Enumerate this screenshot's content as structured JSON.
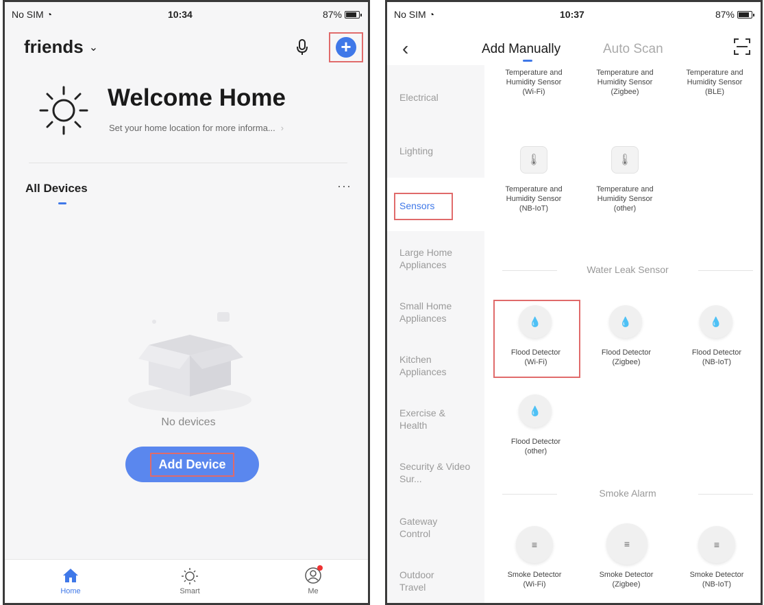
{
  "left": {
    "status": {
      "carrier": "No SIM",
      "time": "10:34",
      "battery": "87%"
    },
    "home_name": "friends",
    "welcome_title": "Welcome Home",
    "welcome_sub": "Set your home location for more informa...",
    "all_devices": "All Devices",
    "more": "···",
    "no_devices": "No devices",
    "add_device": "Add Device",
    "tabs": [
      {
        "label": "Home"
      },
      {
        "label": "Smart"
      },
      {
        "label": "Me"
      }
    ]
  },
  "right": {
    "status": {
      "carrier": "No SIM",
      "time": "10:37",
      "battery": "87%"
    },
    "tab_manual": "Add Manually",
    "tab_scan": "Auto Scan",
    "categories": [
      "Electrical",
      "Lighting",
      "Sensors",
      "Large Home Appliances",
      "Small Home Appliances",
      "Kitchen Appliances",
      "Exercise & Health",
      "Security & Video Sur...",
      "Gateway Control",
      "Outdoor Travel"
    ],
    "th_row1": [
      {
        "name": "Temperature and Humidity Sensor",
        "sub": "(Wi-Fi)"
      },
      {
        "name": "Temperature and Humidity Sensor",
        "sub": "(Zigbee)"
      },
      {
        "name": "Temperature and Humidity Sensor",
        "sub": "(BLE)"
      }
    ],
    "th_row2": [
      {
        "name": "Temperature and Humidity Sensor",
        "sub": "(NB-IoT)"
      },
      {
        "name": "Temperature and Humidity Sensor",
        "sub": "(other)"
      }
    ],
    "water_section": "Water Leak Sensor",
    "flood_row1": [
      {
        "name": "Flood Detector",
        "sub": "(Wi-Fi)"
      },
      {
        "name": "Flood Detector",
        "sub": "(Zigbee)"
      },
      {
        "name": "Flood Detector",
        "sub": "(NB-IoT)"
      }
    ],
    "flood_row2": [
      {
        "name": "Flood Detector",
        "sub": "(other)"
      }
    ],
    "smoke_section": "Smoke Alarm",
    "smoke_row1": [
      {
        "name": "Smoke Detector",
        "sub": "(Wi-Fi)"
      },
      {
        "name": "Smoke Detector",
        "sub": "(Zigbee)"
      },
      {
        "name": "Smoke Detector",
        "sub": "(NB-IoT)"
      }
    ]
  },
  "colors": {
    "accent": "#3f78e8",
    "highlight": "#e06a6a"
  },
  "icons": [
    "wifi-icon",
    "battery-icon",
    "mic-icon",
    "plus-icon",
    "sun-icon",
    "box-icon",
    "home-icon",
    "smart-icon",
    "me-icon",
    "back-icon",
    "scan-icon",
    "thermometer-icon",
    "water-drop-icon",
    "smoke-icon"
  ]
}
